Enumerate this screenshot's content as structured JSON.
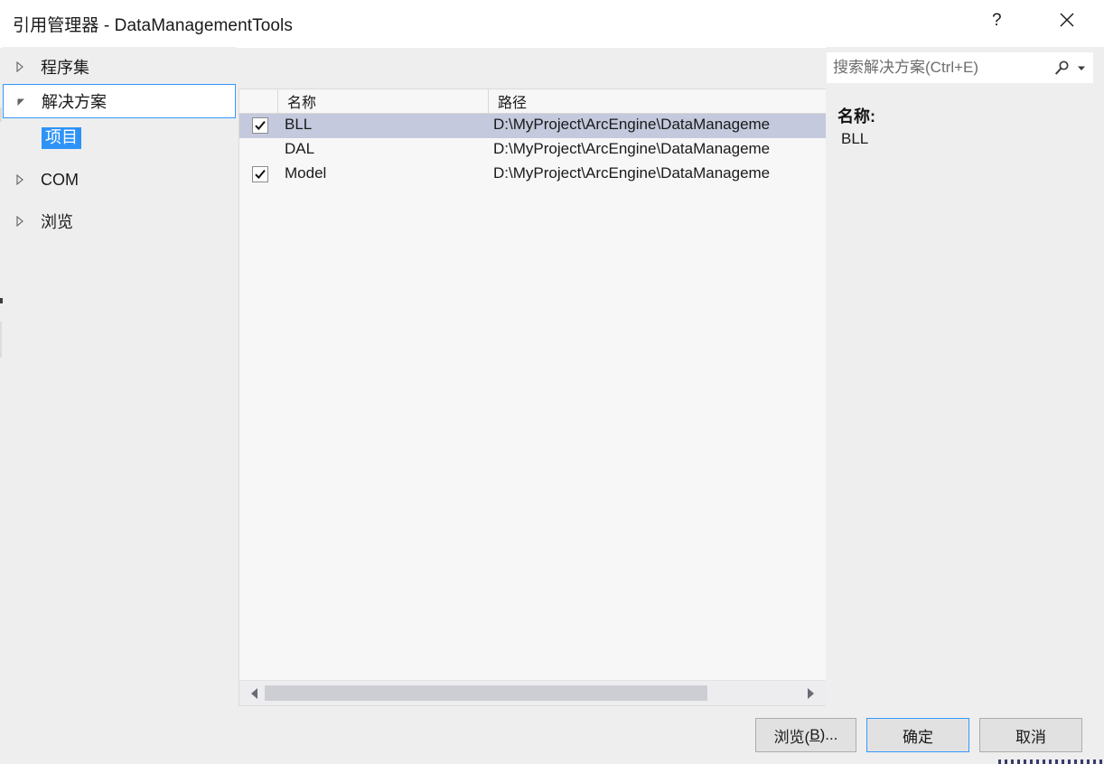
{
  "window": {
    "title": "引用管理器 - DataManagementTools",
    "help_tooltip": "?",
    "close_tooltip": "✕"
  },
  "tree": {
    "nodes": [
      {
        "label": "程序集",
        "level": 0,
        "expanded": false,
        "focused": false,
        "selected": false
      },
      {
        "label": "解决方案",
        "level": 0,
        "expanded": true,
        "focused": true,
        "selected": false
      },
      {
        "label": "项目",
        "level": 1,
        "expanded": null,
        "focused": false,
        "selected": true
      },
      {
        "label": "COM",
        "level": 0,
        "expanded": false,
        "focused": false,
        "selected": false
      },
      {
        "label": "浏览",
        "level": 0,
        "expanded": false,
        "focused": false,
        "selected": false
      }
    ]
  },
  "list": {
    "columns": [
      "",
      "名称",
      "路径"
    ],
    "rows": [
      {
        "checked": true,
        "name": "BLL",
        "path": "D:\\MyProject\\ArcEngine\\DataManageme",
        "selected": true
      },
      {
        "checked": false,
        "name": "DAL",
        "path": "D:\\MyProject\\ArcEngine\\DataManageme",
        "selected": false
      },
      {
        "checked": true,
        "name": "Model",
        "path": "D:\\MyProject\\ArcEngine\\DataManageme",
        "selected": false
      }
    ],
    "scrollbar": {
      "orientation": "horizontal",
      "thumb_percent": 75
    }
  },
  "search": {
    "placeholder": "搜索解决方案(Ctrl+E)",
    "value": ""
  },
  "detail": {
    "name_label": "名称:",
    "name_value": "BLL"
  },
  "buttons": {
    "browse": "浏览(B)...",
    "browse_prefix": "浏览(",
    "browse_accel": "B",
    "browse_suffix": ")...",
    "ok": "确定",
    "cancel": "取消"
  },
  "colors": {
    "dialog_bg": "#eeeeee",
    "titlebar_bg": "#ffffff",
    "accent_blue": "#3399ff",
    "selection_blue": "#2e93f7",
    "row_selected": "#c4c9dd",
    "list_bg": "#f7f7f7",
    "button_bg": "#e1e1e1"
  }
}
